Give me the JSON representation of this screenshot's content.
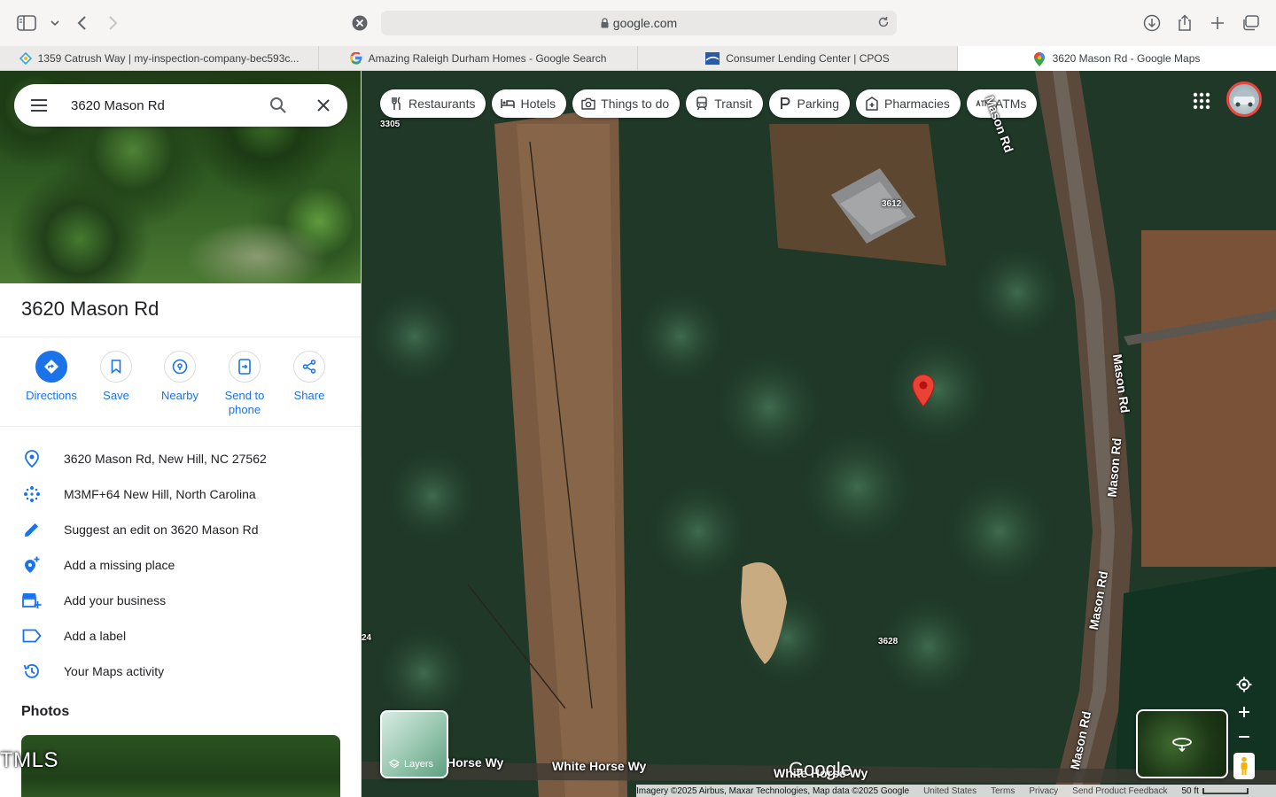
{
  "browser": {
    "url": "google.com",
    "tabs": [
      {
        "title": "1359 Catrush Way | my-inspection-company-bec593c...",
        "icon": "spectora-icon"
      },
      {
        "title": "Amazing Raleigh Durham Homes - Google Search",
        "icon": "google-icon"
      },
      {
        "title": "Consumer Lending Center | CPOS",
        "icon": "bank-icon"
      },
      {
        "title": "3620 Mason Rd - Google Maps",
        "icon": "maps-pin-icon"
      }
    ]
  },
  "search": {
    "value": "3620 Mason Rd"
  },
  "place": {
    "title": "3620 Mason Rd",
    "actions": [
      {
        "label": "Directions"
      },
      {
        "label": "Save"
      },
      {
        "label": "Nearby"
      },
      {
        "label": "Send to phone"
      },
      {
        "label": "Share"
      }
    ],
    "details": [
      {
        "text": "3620 Mason Rd, New Hill, NC 27562",
        "icon": "location-pin-icon"
      },
      {
        "text": "M3MF+64 New Hill, North Carolina",
        "icon": "plus-code-icon"
      },
      {
        "text": "Suggest an edit on 3620 Mason Rd",
        "icon": "pencil-icon"
      },
      {
        "text": "Add a missing place",
        "icon": "add-place-icon"
      },
      {
        "text": "Add your business",
        "icon": "storefront-add-icon"
      },
      {
        "text": "Add a label",
        "icon": "label-icon"
      },
      {
        "text": "Your Maps activity",
        "icon": "history-icon"
      }
    ],
    "photos_heading": "Photos",
    "photo_watermark": "TMLS"
  },
  "map": {
    "chips": [
      {
        "label": "Restaurants",
        "icon": "fork-knife-icon"
      },
      {
        "label": "Hotels",
        "icon": "bed-icon"
      },
      {
        "label": "Things to do",
        "icon": "camera-icon"
      },
      {
        "label": "Transit",
        "icon": "train-icon"
      },
      {
        "label": "Parking",
        "icon": "parking-icon"
      },
      {
        "label": "Pharmacies",
        "icon": "pharmacy-icon"
      },
      {
        "label": "ATMs",
        "icon": "atm-icon"
      }
    ],
    "address_labels": {
      "a3305": "3305",
      "a3612": "3612",
      "a3628": "3628",
      "a24": "24"
    },
    "roads": {
      "mason_1": "Mason Rd",
      "mason_2": "Mason Rd",
      "mason_3": "Mason Rd",
      "mason_4": "Mason Rd",
      "mason_top": "Mason Rd",
      "white_horse_1": "White Horse Wy",
      "white_horse_2": "White Horse Wy",
      "white_horse_3": "Horse Wy"
    },
    "layers_label": "Layers",
    "logo": "Google",
    "footer": {
      "imagery": "Imagery ©2025 Airbus, Maxar Technologies, Map data ©2025 Google",
      "country": "United States",
      "terms": "Terms",
      "privacy": "Privacy",
      "feedback": "Send Product Feedback",
      "scale": "50 ft"
    },
    "colors": {
      "marker": "#ea4335",
      "accent": "#1a73e8"
    }
  }
}
